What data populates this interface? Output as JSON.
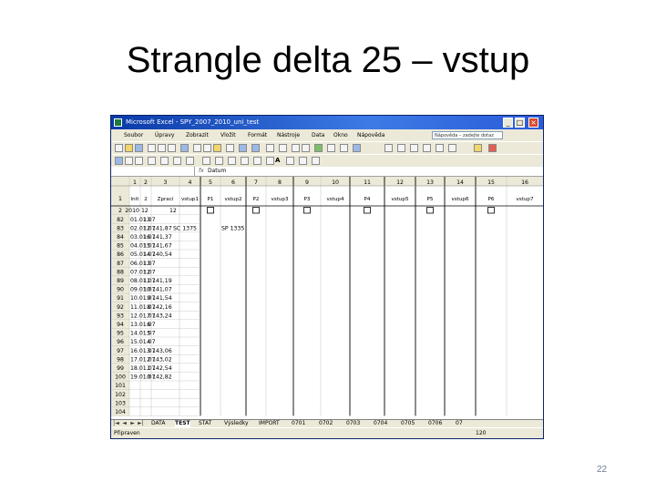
{
  "slide": {
    "title": "Strangle delta 25 – vstup",
    "page_number": "22"
  },
  "window": {
    "title": "Microsoft Excel - SPY_2007_2010_uni_test",
    "controls": [
      "_",
      "□",
      "×"
    ],
    "menu": [
      "Soubor",
      "Úpravy",
      "Zobrazit",
      "Vložit",
      "Formát",
      "Nástroje",
      "Data",
      "Okno",
      "Nápověda"
    ],
    "help_placeholder": "Nápověda – zadejte dotaz"
  },
  "formula_bar": {
    "fx": "fx",
    "content": "Datum"
  },
  "sheet": {
    "column_numbers": [
      "1",
      "2",
      "3",
      "4",
      "5",
      "6",
      "7",
      "8",
      "9",
      "10",
      "11",
      "12",
      "13",
      "14",
      "15",
      "16"
    ],
    "header_row": {
      "row_label": "1",
      "cells": [
        "Init",
        "2",
        "Zprací",
        "vstup1",
        "P1",
        "vstup2",
        "P2",
        "vstup3",
        "P3",
        "vstup4",
        "P4",
        "vstup5",
        "P5",
        "vstup6",
        "P6",
        "vstup7"
      ]
    },
    "row2": {
      "row_label": "2",
      "values": [
        "2010",
        "12",
        "12"
      ]
    },
    "rows": [
      {
        "r": "82",
        "date": "01.01.07",
        "n": "13",
        "v": "",
        "note": "",
        "note2": ""
      },
      {
        "r": "83",
        "date": "02.01.07",
        "n": "12",
        "v": "141,87",
        "note": "SC 1375",
        "note2": "SP 1335"
      },
      {
        "r": "84",
        "date": "03.01.07",
        "n": "16",
        "v": "141,37",
        "note": "",
        "note2": ""
      },
      {
        "r": "85",
        "date": "04.01.07",
        "n": "15",
        "v": "141,67",
        "note": "",
        "note2": ""
      },
      {
        "r": "86",
        "date": "05.01.07",
        "n": "14",
        "v": "140,54",
        "note": "",
        "note2": ""
      },
      {
        "r": "87",
        "date": "06.01.07",
        "n": "13",
        "v": "",
        "note": "",
        "note2": ""
      },
      {
        "r": "88",
        "date": "07.01.07",
        "n": "12",
        "v": "",
        "note": "",
        "note2": ""
      },
      {
        "r": "89",
        "date": "08.01.07",
        "n": "11",
        "v": "141,19",
        "note": "",
        "note2": ""
      },
      {
        "r": "90",
        "date": "09.01.07",
        "n": "10",
        "v": "141,07",
        "note": "",
        "note2": ""
      },
      {
        "r": "91",
        "date": "10.01.07",
        "n": "9",
        "v": "141,54",
        "note": "",
        "note2": ""
      },
      {
        "r": "92",
        "date": "11.01.07",
        "n": "8",
        "v": "142,16",
        "note": "",
        "note2": ""
      },
      {
        "r": "93",
        "date": "12.01.07",
        "n": "7",
        "v": "143,24",
        "note": "",
        "note2": ""
      },
      {
        "r": "94",
        "date": "13.01.07",
        "n": "6",
        "v": "",
        "note": "",
        "note2": ""
      },
      {
        "r": "95",
        "date": "14.01.07",
        "n": "5",
        "v": "",
        "note": "",
        "note2": ""
      },
      {
        "r": "96",
        "date": "15.01.07",
        "n": "4",
        "v": "",
        "note": "",
        "note2": ""
      },
      {
        "r": "97",
        "date": "16.01.07",
        "n": "3",
        "v": "143,06",
        "note": "",
        "note2": ""
      },
      {
        "r": "98",
        "date": "17.01.07",
        "n": "2",
        "v": "143,02",
        "note": "",
        "note2": ""
      },
      {
        "r": "99",
        "date": "18.01.07",
        "n": "1",
        "v": "142,54",
        "note": "",
        "note2": ""
      },
      {
        "r": "100",
        "date": "19.01.07",
        "n": "0",
        "v": "142,82",
        "note": "",
        "note2": ""
      }
    ],
    "empty_rows": [
      "101",
      "102",
      "103",
      "104"
    ]
  },
  "sheet_tabs": {
    "nav": [
      "|◄",
      "◄",
      "►",
      "►|"
    ],
    "tabs": [
      "DATA",
      "TEST",
      "STAT",
      "Výsledky",
      "IMPORT",
      "0701",
      "0702",
      "0703",
      "0704",
      "0705",
      "0706",
      "07"
    ],
    "active": "TEST"
  },
  "status": {
    "text": "Připraven",
    "number": "120"
  },
  "colors": {
    "grid": "#c0c0c0",
    "header_bg": "#ece9d8",
    "title_bar": "#0a3aa8"
  }
}
